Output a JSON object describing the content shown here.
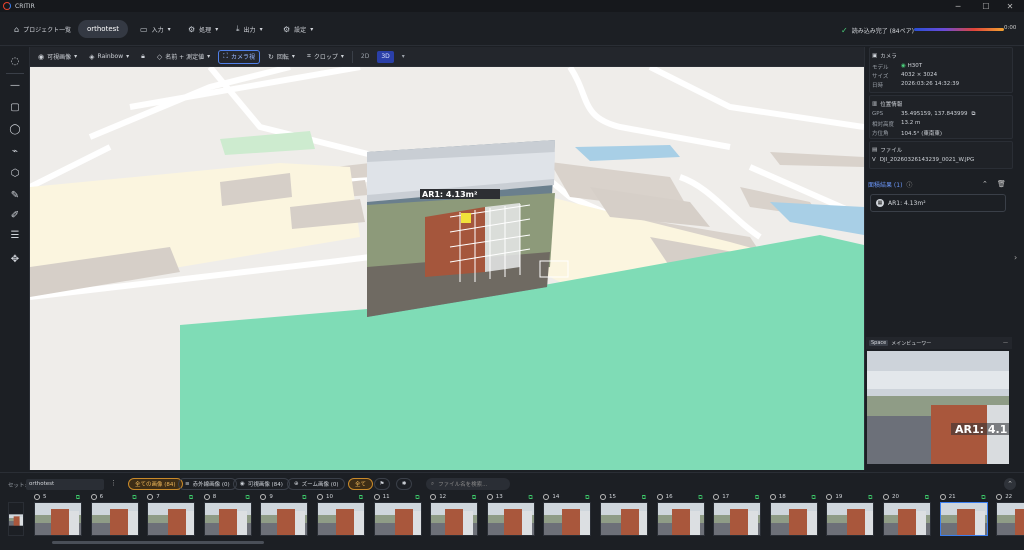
{
  "app": {
    "title": "CRITIR"
  },
  "window": {
    "minimize": "─",
    "maximize": "☐",
    "close": "✕"
  },
  "menu": {
    "project_list": "プロジェクト一覧",
    "project_name": "orthotest",
    "input": "入力",
    "process": "処理",
    "output": "出力",
    "settings": "設定",
    "status": "読み込み完了 (84ペア)",
    "progress_time": "0:00"
  },
  "toolbar": {
    "visible_image": "可視画像",
    "colormap": "Rainbow",
    "label_mode": "名前 + 測定値",
    "camera_view": "カメラ視",
    "rotate": "回転",
    "crop": "クロップ",
    "mode_2d": "2D",
    "mode_3d": "3D"
  },
  "viewport": {
    "annotation_label": "AR1: 4.13m²"
  },
  "camera_panel": {
    "title": "カメラ",
    "model_key": "モデル",
    "model_val": "H30T",
    "size_key": "サイズ",
    "size_val": "4032 × 3024",
    "date_key": "日時",
    "date_val": "2026:03:26 14:32:39"
  },
  "position_panel": {
    "title": "位置情報",
    "gps_key": "GPS",
    "gps_val": "35.495159, 137.843999",
    "alt_key": "相対高度",
    "alt_val": "13.2 m",
    "heading_key": "方位角",
    "heading_val": "104.5° (東南東)"
  },
  "file_panel": {
    "title": "ファイル",
    "file_name": "DJI_20260326143239_0021_W.JPG"
  },
  "annotations": {
    "header": "面積結果 (1)",
    "item": "AR1: 4.13m²"
  },
  "minimap": {
    "space_key": "Space",
    "title": "メインビューワー",
    "overlay_label": "AR1: 4.1"
  },
  "filmstrip": {
    "set_label": "セット:",
    "set_value": "orthotest",
    "all_images": "全ての画像 (84)",
    "ir_images": "赤外線画像 (0)",
    "visible_images": "可視画像 (84)",
    "zoom_images": "ズーム画像 (0)",
    "all": "全て",
    "search_placeholder": "ファイル名を検索...",
    "frames": [
      "",
      "5",
      "6",
      "7",
      "8",
      "9",
      "10",
      "11",
      "12",
      "13",
      "14",
      "15",
      "16",
      "17",
      "18",
      "19",
      "20",
      "21",
      "22"
    ],
    "selected_frame": "21"
  },
  "colors": {
    "accent": "#3a7ef0",
    "status_ok": "#4ad07a",
    "filter_on": "#f0b85a",
    "green_area": "#7fdcb6"
  }
}
